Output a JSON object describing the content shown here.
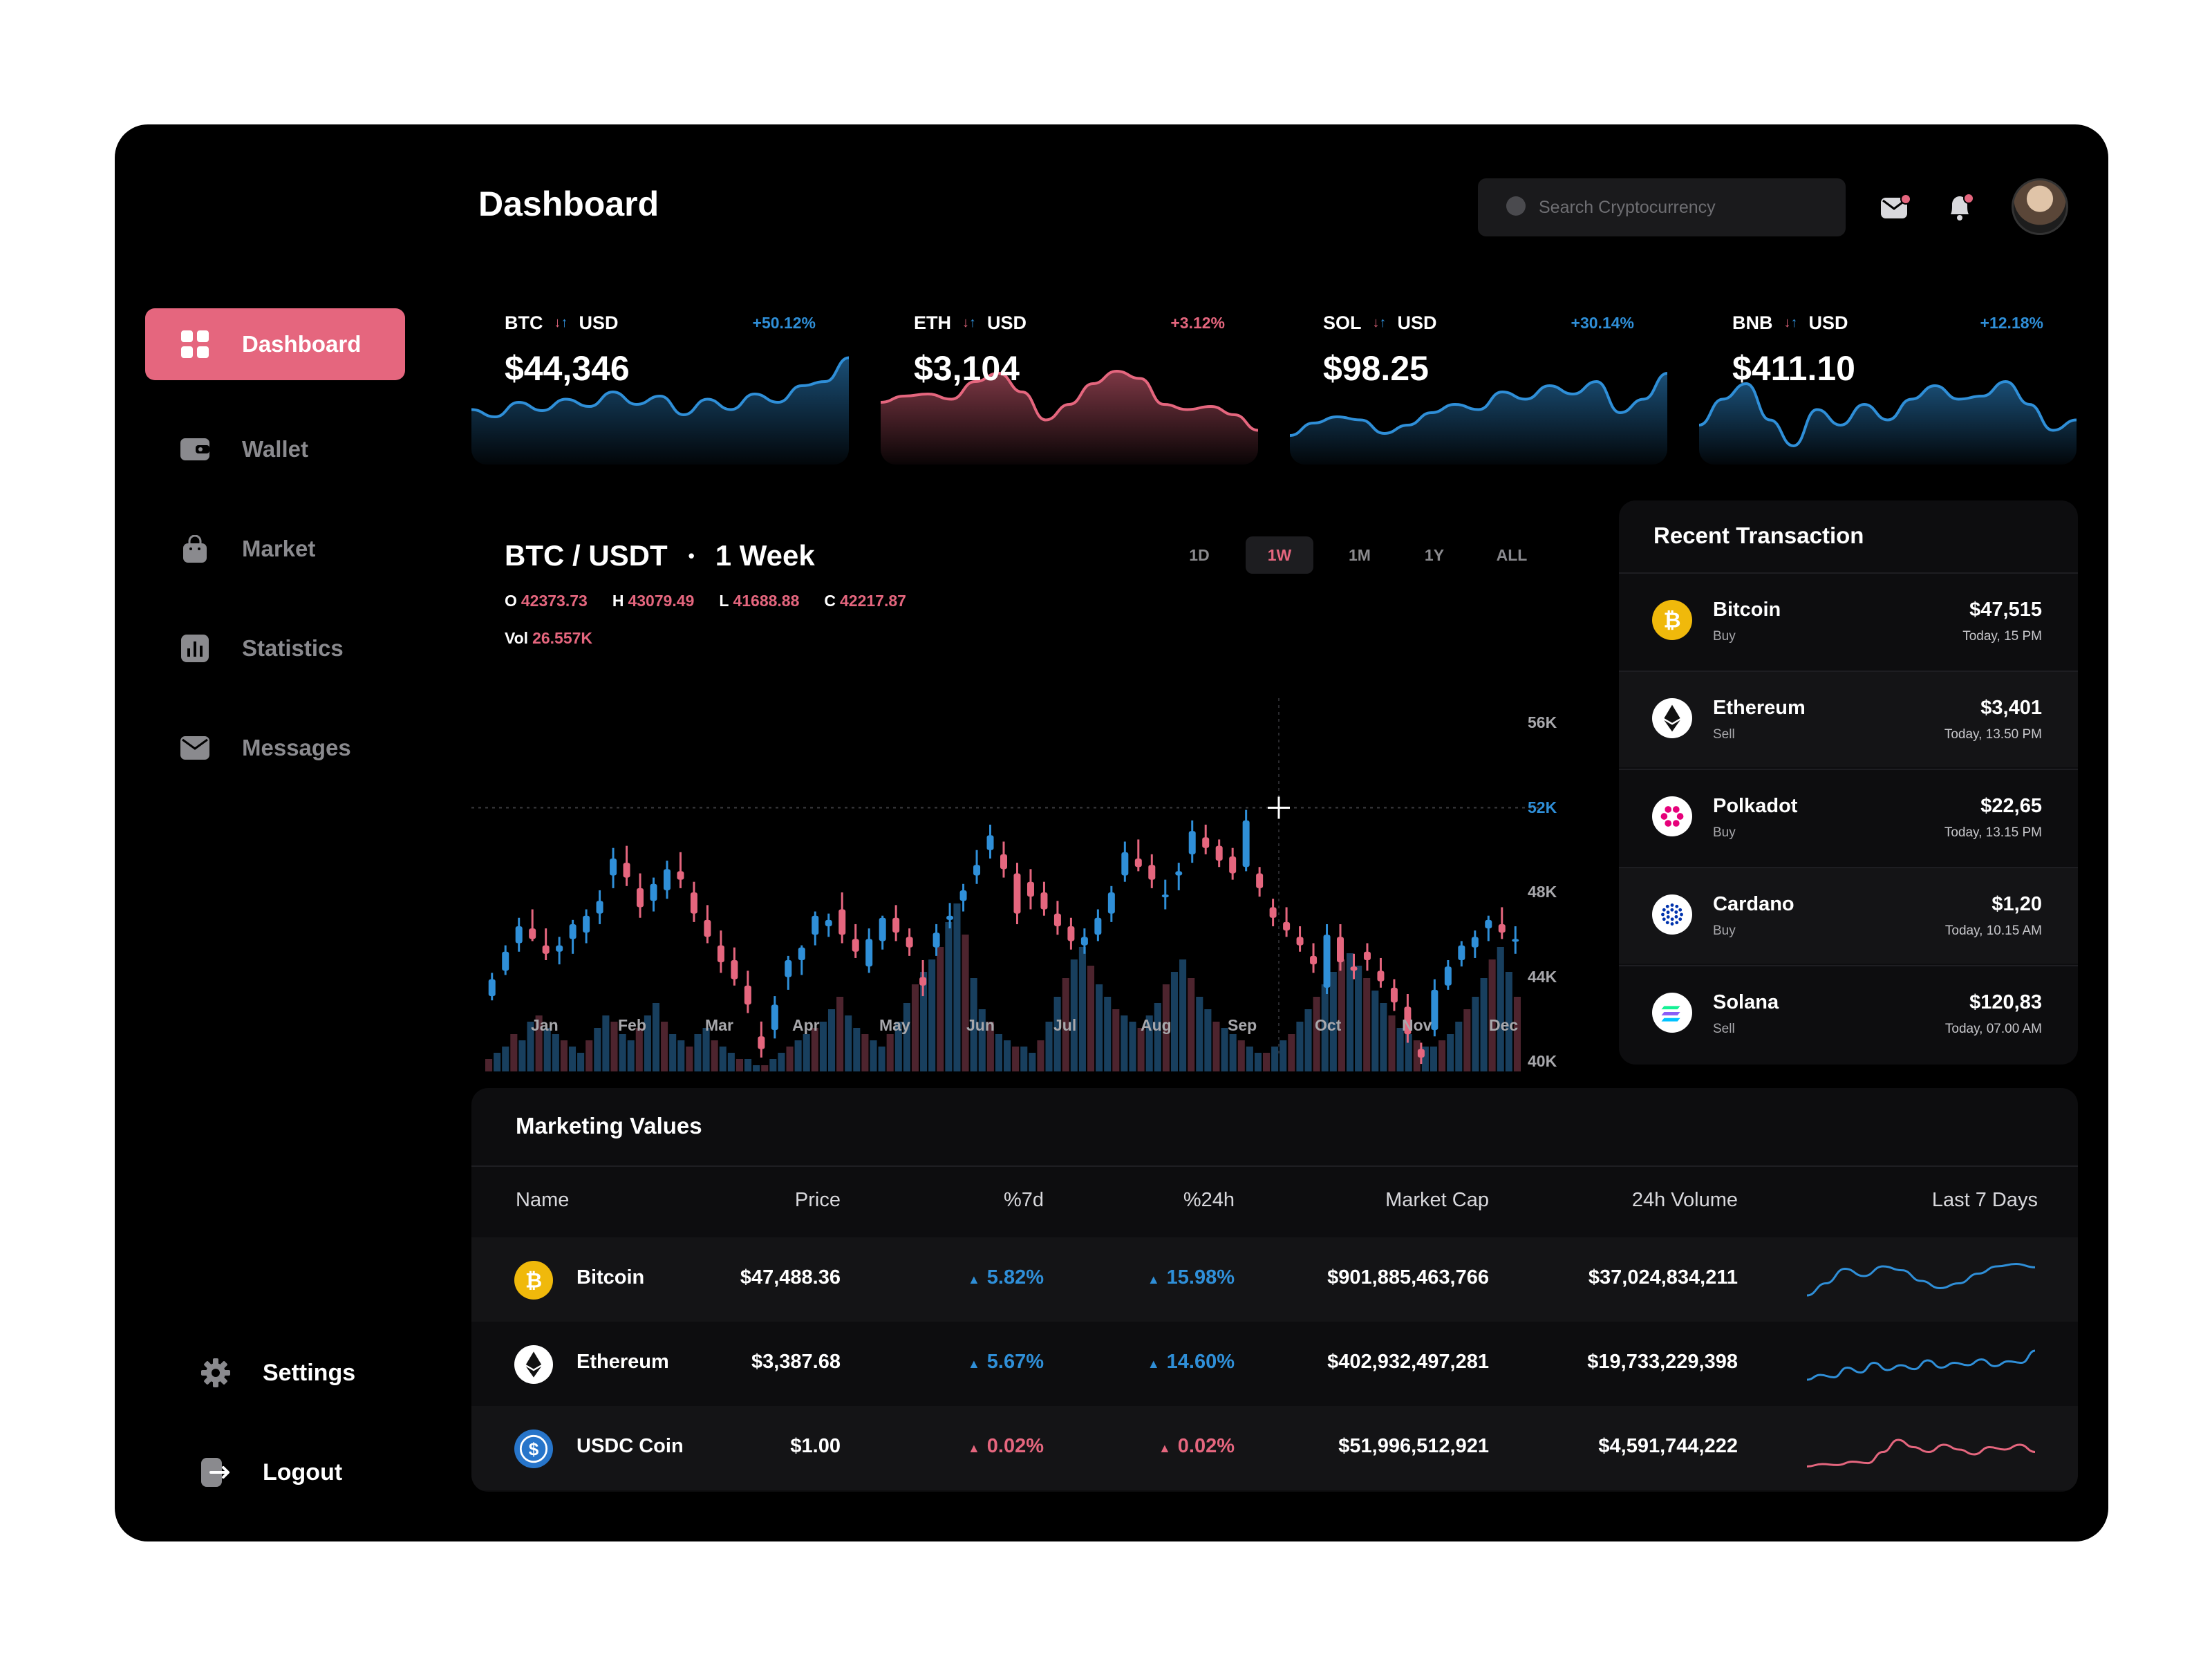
{
  "header": {
    "title": "Dashboard",
    "search_placeholder": "Search Cryptocurrency"
  },
  "sidebar": {
    "items": [
      {
        "label": "Dashboard",
        "icon": "grid-icon",
        "active": true
      },
      {
        "label": "Wallet",
        "icon": "wallet-icon"
      },
      {
        "label": "Market",
        "icon": "bag-icon"
      },
      {
        "label": "Statistics",
        "icon": "bar-chart-icon"
      },
      {
        "label": "Messages",
        "icon": "envelope-icon"
      }
    ],
    "bottom": [
      {
        "label": "Settings",
        "icon": "gear-icon"
      },
      {
        "label": "Logout",
        "icon": "logout-icon"
      }
    ]
  },
  "tickers": [
    {
      "base": "BTC",
      "quote": "USD",
      "price": "$44,346",
      "change": "+50.12%",
      "trend": "up",
      "color": "#2f8fd8",
      "spark": [
        0.45,
        0.38,
        0.52,
        0.44,
        0.55,
        0.48,
        0.62,
        0.5,
        0.58,
        0.4,
        0.55,
        0.45,
        0.6,
        0.52,
        0.68,
        0.72,
        0.95
      ]
    },
    {
      "base": "ETH",
      "quote": "USD",
      "price": "$3,104",
      "change": "+3.12%",
      "trend": "down",
      "color": "#e5667e",
      "spark": [
        0.52,
        0.58,
        0.6,
        0.55,
        0.72,
        0.8,
        0.62,
        0.35,
        0.5,
        0.7,
        0.82,
        0.75,
        0.5,
        0.45,
        0.48,
        0.4,
        0.25
      ]
    },
    {
      "base": "SOL",
      "quote": "USD",
      "price": "$98.25",
      "change": "+30.14%",
      "trend": "up",
      "color": "#2f8fd8",
      "spark": [
        0.2,
        0.32,
        0.38,
        0.35,
        0.22,
        0.3,
        0.42,
        0.5,
        0.45,
        0.62,
        0.55,
        0.68,
        0.6,
        0.72,
        0.42,
        0.55,
        0.8
      ]
    },
    {
      "base": "BNB",
      "quote": "USD",
      "price": "$411.10",
      "change": "+12.18%",
      "trend": "up",
      "color": "#2f8fd8",
      "spark": [
        0.3,
        0.55,
        0.7,
        0.35,
        0.1,
        0.45,
        0.3,
        0.5,
        0.35,
        0.55,
        0.68,
        0.55,
        0.58,
        0.72,
        0.5,
        0.25,
        0.35
      ]
    }
  ],
  "main_chart": {
    "pair": "BTC / USDT",
    "period": "1 Week",
    "ohlc": {
      "o_label": "O",
      "o": "42373.73",
      "h_label": "H",
      "h": "43079.49",
      "l_label": "L",
      "l": "41688.88",
      "c_label": "C",
      "c": "42217.87"
    },
    "vol_label": "Vol",
    "vol": "26.557K",
    "timeframes": [
      "1D",
      "1W",
      "1M",
      "1Y",
      "ALL"
    ],
    "active_timeframe": "1W"
  },
  "chart_data": {
    "type": "candlestick",
    "x_labels": [
      "Jan",
      "Feb",
      "Mar",
      "Apr",
      "May",
      "Jun",
      "Jul",
      "Aug",
      "Sep",
      "Oct",
      "Nov",
      "Dec"
    ],
    "y_ticks": [
      "56K",
      "52K",
      "48K",
      "44K",
      "40K"
    ],
    "highlight_tick": "52K",
    "ylim": [
      40000,
      56000
    ],
    "candles": [
      [
        43100,
        44200,
        42900,
        43900
      ],
      [
        44300,
        45500,
        44100,
        45200
      ],
      [
        45600,
        46800,
        45200,
        46400
      ],
      [
        46300,
        47200,
        45700,
        45800
      ],
      [
        45500,
        46300,
        44800,
        45100
      ],
      [
        45200,
        45900,
        44600,
        45500
      ],
      [
        45800,
        46700,
        45100,
        46500
      ],
      [
        46100,
        47200,
        45600,
        46900
      ],
      [
        47000,
        48100,
        46500,
        47600
      ],
      [
        48800,
        50100,
        48200,
        49600
      ],
      [
        49400,
        50200,
        48300,
        48700
      ],
      [
        48200,
        48900,
        46800,
        47300
      ],
      [
        47600,
        48700,
        47100,
        48400
      ],
      [
        48100,
        49500,
        47700,
        49100
      ],
      [
        49000,
        49900,
        48200,
        48600
      ],
      [
        48000,
        48500,
        46600,
        47000
      ],
      [
        46700,
        47400,
        45600,
        45900
      ],
      [
        45500,
        46200,
        44200,
        44700
      ],
      [
        44800,
        45400,
        43600,
        43900
      ],
      [
        43600,
        44300,
        42300,
        42700
      ],
      [
        41200,
        41900,
        40200,
        40600
      ],
      [
        41500,
        43100,
        41100,
        42700
      ],
      [
        44000,
        45000,
        43400,
        44800
      ],
      [
        44800,
        45500,
        44100,
        45400
      ],
      [
        46000,
        47100,
        45500,
        46900
      ],
      [
        46400,
        47000,
        45900,
        46700
      ],
      [
        47200,
        48000,
        45600,
        46000
      ],
      [
        45800,
        46500,
        44900,
        45200
      ],
      [
        44500,
        46300,
        44200,
        45800
      ],
      [
        45700,
        46900,
        45300,
        46800
      ],
      [
        46800,
        47400,
        45700,
        46100
      ],
      [
        45900,
        46300,
        45000,
        45400
      ],
      [
        44000,
        44800,
        43100,
        43600
      ],
      [
        45400,
        46500,
        45000,
        46100
      ],
      [
        46700,
        47500,
        46300,
        46900
      ],
      [
        47600,
        48400,
        47100,
        48100
      ],
      [
        48800,
        50000,
        48400,
        49300
      ],
      [
        50000,
        51200,
        49600,
        50700
      ],
      [
        49800,
        50400,
        48700,
        49100
      ],
      [
        48900,
        49400,
        46500,
        47000
      ],
      [
        48500,
        49100,
        47200,
        47800
      ],
      [
        48000,
        48500,
        46900,
        47200
      ],
      [
        47000,
        47600,
        46000,
        46400
      ],
      [
        46400,
        46800,
        45300,
        45700
      ],
      [
        45500,
        46300,
        45100,
        45900
      ],
      [
        46000,
        47200,
        45700,
        46800
      ],
      [
        47000,
        48300,
        46600,
        48000
      ],
      [
        48800,
        50400,
        48500,
        49900
      ],
      [
        49600,
        50500,
        49000,
        49200
      ],
      [
        49300,
        49800,
        48200,
        48600
      ],
      [
        47900,
        48600,
        47200,
        47900
      ],
      [
        48800,
        49400,
        48100,
        49000
      ],
      [
        49800,
        51400,
        49400,
        50900
      ],
      [
        50600,
        51200,
        49800,
        50100
      ],
      [
        50200,
        50500,
        49200,
        49500
      ],
      [
        49700,
        50100,
        48600,
        48900
      ],
      [
        49200,
        51900,
        49000,
        51400
      ],
      [
        48900,
        49200,
        47800,
        48200
      ],
      [
        47300,
        47700,
        46400,
        46800
      ],
      [
        46600,
        47300,
        45900,
        46200
      ],
      [
        45900,
        46400,
        45200,
        45500
      ],
      [
        45000,
        45600,
        44200,
        44600
      ],
      [
        43500,
        46500,
        43200,
        46000
      ],
      [
        45900,
        46500,
        44300,
        44700
      ],
      [
        44500,
        45100,
        43900,
        44300
      ],
      [
        45200,
        45600,
        44300,
        44800
      ],
      [
        44300,
        44900,
        43500,
        43800
      ],
      [
        43500,
        43900,
        42400,
        42800
      ],
      [
        42600,
        43200,
        40900,
        41300
      ],
      [
        40600,
        40900,
        39900,
        40200
      ],
      [
        41500,
        43900,
        41200,
        43400
      ],
      [
        43600,
        44800,
        43400,
        44500
      ],
      [
        44800,
        45700,
        44500,
        45500
      ],
      [
        45400,
        46200,
        44900,
        45900
      ],
      [
        46300,
        46900,
        45700,
        46700
      ],
      [
        46500,
        47300,
        45800,
        46100
      ],
      [
        45700,
        46400,
        45100,
        45800
      ]
    ],
    "volume": [
      2,
      3,
      4,
      6,
      5,
      8,
      9,
      7,
      6,
      5,
      4,
      3,
      5,
      7,
      9,
      8,
      6,
      5,
      7,
      9,
      11,
      8,
      6,
      5,
      4,
      6,
      7,
      5,
      4,
      3,
      2,
      2,
      1,
      1,
      2,
      3,
      4,
      5,
      6,
      7,
      8,
      10,
      12,
      9,
      7,
      6,
      5,
      4,
      6,
      8,
      11,
      14,
      16,
      18,
      20,
      24,
      27,
      22,
      15,
      10,
      8,
      6,
      5,
      4,
      4,
      3,
      5,
      8,
      12,
      15,
      18,
      20,
      17,
      14,
      12,
      10,
      9,
      8,
      7,
      9,
      11,
      14,
      16,
      18,
      15,
      12,
      10,
      8,
      7,
      6,
      5,
      4,
      3,
      3,
      4,
      5,
      6,
      8,
      10,
      12,
      14,
      16,
      18,
      19,
      17,
      15,
      13,
      11,
      9,
      7,
      6,
      5,
      4,
      4,
      5,
      6,
      8,
      10,
      12,
      15,
      18,
      20,
      16,
      12
    ],
    "vol_colors_pattern": "mixed"
  },
  "recent_transactions": {
    "title": "Recent Transaction",
    "items": [
      {
        "name": "Bitcoin",
        "type": "Buy",
        "amount": "$47,515",
        "time": "Today, 15 PM",
        "icon": "bitcoin-icon",
        "color": "#f0b90b"
      },
      {
        "name": "Ethereum",
        "type": "Sell",
        "amount": "$3,401",
        "time": "Today, 13.50 PM",
        "icon": "ethereum-icon",
        "color": "#ffffff"
      },
      {
        "name": "Polkadot",
        "type": "Buy",
        "amount": "$22,65",
        "time": "Today, 13.15 PM",
        "icon": "polkadot-icon",
        "color": "#ffffff"
      },
      {
        "name": "Cardano",
        "type": "Buy",
        "amount": "$1,20",
        "time": "Today, 10.15 AM",
        "icon": "cardano-icon",
        "color": "#ffffff"
      },
      {
        "name": "Solana",
        "type": "Sell",
        "amount": "$120,83",
        "time": "Today, 07.00 AM",
        "icon": "solana-icon",
        "color": "#ffffff"
      }
    ]
  },
  "marketing": {
    "title": "Marketing Values",
    "columns": [
      "Name",
      "Price",
      "%7d",
      "%24h",
      "Market Cap",
      "24h Volume",
      "Last 7 Days"
    ],
    "rows": [
      {
        "name": "Bitcoin",
        "price": "$47,488.36",
        "d7": "5.82%",
        "h24": "15.98%",
        "mcap": "$901,885,463,766",
        "vol": "$37,024,834,211",
        "trend": "up",
        "icon": "bitcoin-icon",
        "spark": [
          0.2,
          0.45,
          0.75,
          0.6,
          0.8,
          0.72,
          0.5,
          0.35,
          0.45,
          0.65,
          0.8,
          0.85,
          0.78
        ]
      },
      {
        "name": "Ethereum",
        "price": "$3,387.68",
        "d7": "5.67%",
        "h24": "14.60%",
        "mcap": "$402,932,497,281",
        "vol": "$19,733,229,398",
        "trend": "up",
        "icon": "ethereum-icon",
        "spark": [
          0.2,
          0.3,
          0.25,
          0.45,
          0.35,
          0.55,
          0.4,
          0.5,
          0.42,
          0.6,
          0.45,
          0.55,
          0.5,
          0.62,
          0.48,
          0.58,
          0.55,
          0.8
        ]
      },
      {
        "name": "USDC Coin",
        "price": "$1.00",
        "d7": "0.02%",
        "h24": "0.02%",
        "mcap": "$51,996,512,921",
        "vol": "$4,591,744,222",
        "trend": "down",
        "icon": "usdc-icon",
        "spark": [
          0.15,
          0.2,
          0.18,
          0.25,
          0.22,
          0.45,
          0.7,
          0.55,
          0.45,
          0.6,
          0.5,
          0.4,
          0.55,
          0.5,
          0.6,
          0.45
        ]
      }
    ]
  }
}
